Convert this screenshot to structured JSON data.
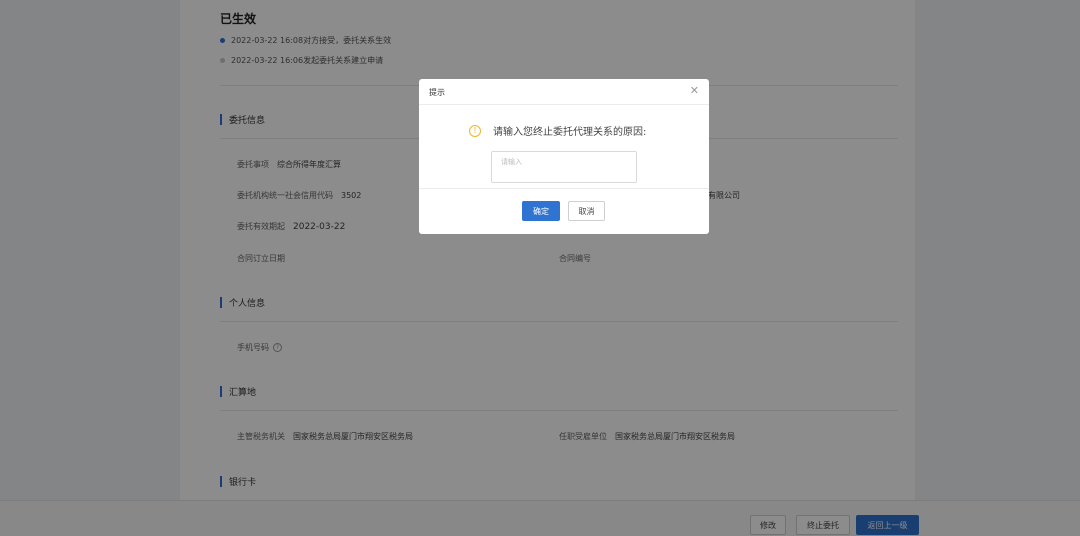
{
  "status": {
    "title": "已生效",
    "timeline": [
      {
        "text": "2022-03-22 16:08对方接受，委托关系生效",
        "color": "#2f6fd6"
      },
      {
        "text": "2022-03-22 16:06发起委托关系建立申请",
        "color": "#c8c8c8"
      }
    ]
  },
  "sections": {
    "entrust": {
      "title": "委托信息",
      "matter_label": "委托事项",
      "matter_value": "综合所得年度汇算",
      "org_code_label": "委托机构统一社会信用代码",
      "org_code_value": "3502",
      "company_suffix": "有限公司",
      "valid_label": "委托有效期起",
      "valid_value": "2022-03-22",
      "contract_date_label": "合同订立日期",
      "contract_no_label": "合同编号"
    },
    "personal": {
      "title": "个人信息",
      "phone_label": "手机号码",
      "help_icon": "question-circle-icon"
    },
    "settlement": {
      "title": "汇算地",
      "tax_authority_label": "主管税务机关",
      "tax_authority_value": "国家税务总局厦门市翔安区税务局",
      "employer_label": "任职受雇单位",
      "employer_value": "国家税务总局厦门市翔安区税务局"
    },
    "bank": {
      "title": "银行卡"
    }
  },
  "footer": {
    "modify": "修改",
    "terminate": "终止委托",
    "back": "返回上一级"
  },
  "modal": {
    "title": "提示",
    "close_icon": "close-icon",
    "message": "请输入您终止委托代理关系的原因:",
    "warn_icon": "info-circle-icon",
    "input_placeholder": "请输入",
    "input_value": "",
    "confirm": "确定",
    "cancel": "取消"
  },
  "colors": {
    "accent": "#2f6fd6",
    "primary_button": "#2f74d0",
    "warning": "#f0b429"
  }
}
